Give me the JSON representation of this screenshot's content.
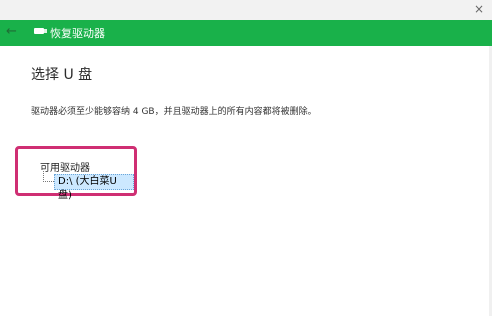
{
  "window": {
    "title": "恢复驱动器",
    "close_glyph": "×",
    "back_glyph": "←"
  },
  "page": {
    "heading": "选择 U 盘",
    "description": "驱动器必须至少能够容纳 4 GB，并且驱动器上的所有内容都将被删除。"
  },
  "drives": {
    "group_label": "可用驱动器",
    "items": [
      {
        "label": "D:\\ (大白菜U盘)",
        "selected": true
      }
    ]
  },
  "colors": {
    "title_bar": "#19b14a",
    "highlight_border": "#cf2f73",
    "selection": "#cce8ff"
  }
}
